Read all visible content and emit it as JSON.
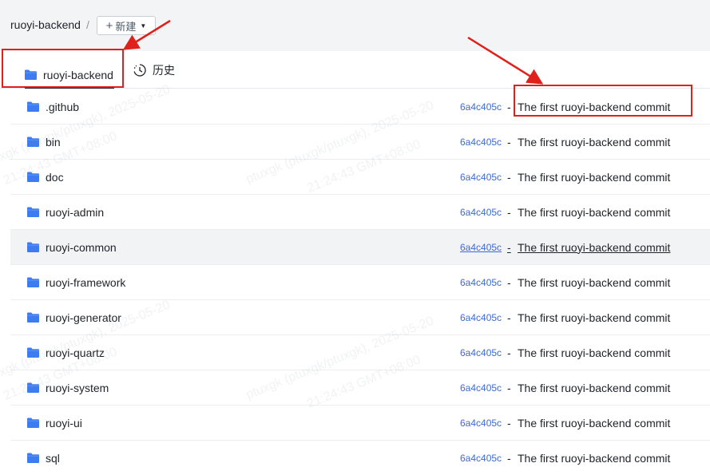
{
  "header": {
    "repo_name": "ruoyi-backend",
    "separator": "/",
    "new_button_label": "新建"
  },
  "tabs": {
    "files_label": "ruoyi-backend",
    "history_label": "历史"
  },
  "files": [
    {
      "name": ".github",
      "commit_hash": "6a4c405c",
      "commit_message": "The first ruoyi-backend commit"
    },
    {
      "name": "bin",
      "commit_hash": "6a4c405c",
      "commit_message": "The first ruoyi-backend commit"
    },
    {
      "name": "doc",
      "commit_hash": "6a4c405c",
      "commit_message": "The first ruoyi-backend commit"
    },
    {
      "name": "ruoyi-admin",
      "commit_hash": "6a4c405c",
      "commit_message": "The first ruoyi-backend commit"
    },
    {
      "name": "ruoyi-common",
      "commit_hash": "6a4c405c",
      "commit_message": "The first ruoyi-backend commit"
    },
    {
      "name": "ruoyi-framework",
      "commit_hash": "6a4c405c",
      "commit_message": "The first ruoyi-backend commit"
    },
    {
      "name": "ruoyi-generator",
      "commit_hash": "6a4c405c",
      "commit_message": "The first ruoyi-backend commit"
    },
    {
      "name": "ruoyi-quartz",
      "commit_hash": "6a4c405c",
      "commit_message": "The first ruoyi-backend commit"
    },
    {
      "name": "ruoyi-system",
      "commit_hash": "6a4c405c",
      "commit_message": "The first ruoyi-backend commit"
    },
    {
      "name": "ruoyi-ui",
      "commit_hash": "6a4c405c",
      "commit_message": "The first ruoyi-backend commit"
    },
    {
      "name": "sql",
      "commit_hash": "6a4c405c",
      "commit_message": "The first ruoyi-backend commit"
    }
  ],
  "watermark_text": [
    "ptuxgk (ptuxgk/ptuxgk), 2025-05-20",
    "21:24:43 GMT+08:00"
  ],
  "icons": {
    "folder": "folder-icon",
    "history": "history-clock-icon",
    "plus": "plus-icon",
    "caret": "caret-down-icon"
  },
  "colors": {
    "folder_blue": "#3d7bf0",
    "hash_blue": "#3c6ad4",
    "annotation_red": "#e0201b"
  }
}
